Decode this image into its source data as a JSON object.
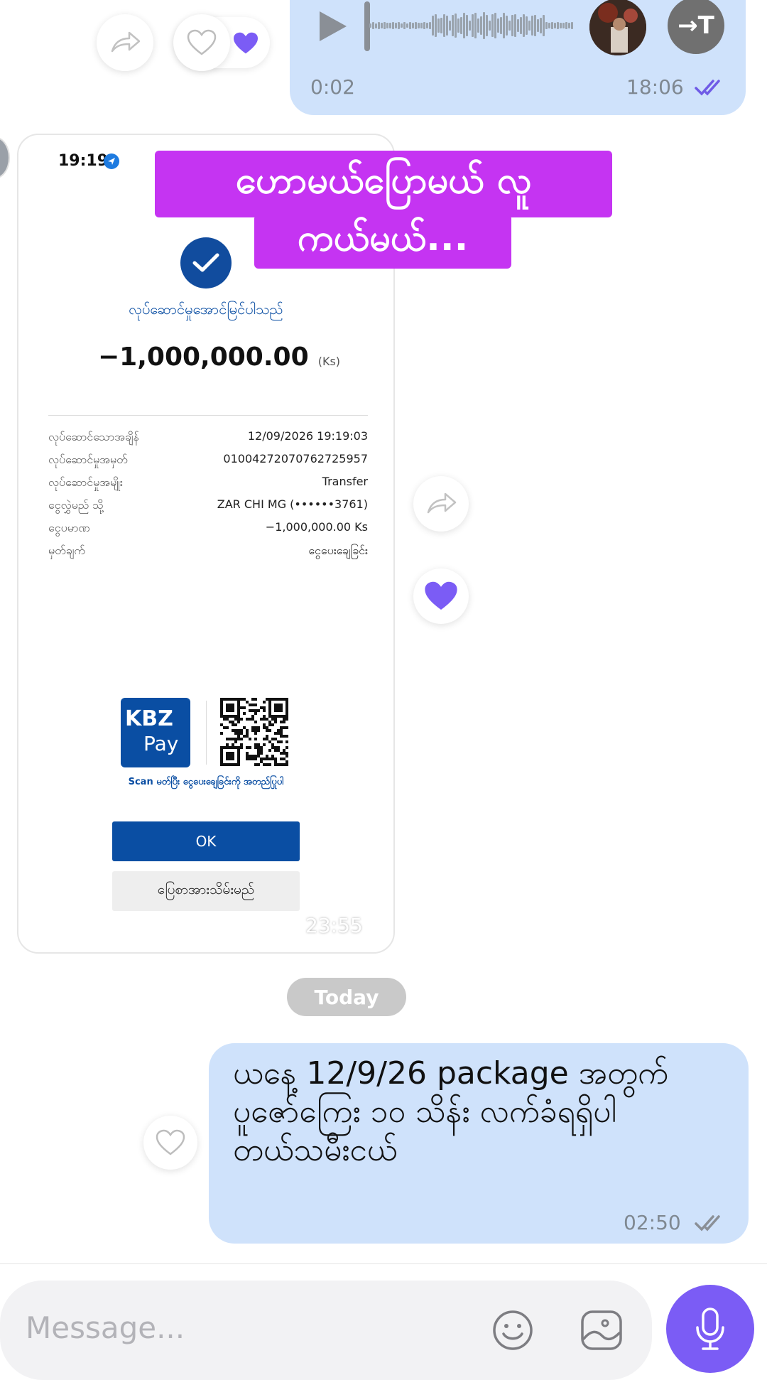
{
  "voice_message": {
    "duration": "0:02",
    "time": "18:06",
    "transcribe_label": "→T",
    "colors": {
      "bubble": "#cfe2fb",
      "ticks": "#6f5be6"
    }
  },
  "reactions": {
    "forward_icon": "forward-arrow-icon",
    "like_icon": "heart-icon",
    "liked_color": "#7b5cf5"
  },
  "receipt": {
    "status_time": "19:19",
    "sticker_line1": "ဟောမယ်ပြောမယ် လူ",
    "sticker_line2": "ကယ်မယ်...",
    "success_text": "လုပ်ဆောင်မှုအောင်မြင်ပါသည်",
    "amount": "−1,000,000.00",
    "currency": "(Ks)",
    "details": [
      {
        "label": "လုပ်ဆောင်သောအချိန်",
        "value": "12/09/2026 19:19:03"
      },
      {
        "label": "လုပ်ဆောင်မှုအမှတ်",
        "value": "01004272070762725957"
      },
      {
        "label": "လုပ်ဆောင်မှုအမျိုး",
        "value": "Transfer"
      },
      {
        "label": "ငွေလွှဲမည် သို့",
        "value": "ZAR CHI MG (••••••3761)"
      },
      {
        "label": "ငွေပမာဏ",
        "value": "−1,000,000.00 Ks"
      },
      {
        "label": "မှတ်ချက်",
        "value": "ငွေပေးချေခြင်း"
      }
    ],
    "logo_line1": "KBZ",
    "logo_line2": "Pay",
    "scan_text": "Scan မတ်ပြီး ငွေပေးချေခြင်းကို အတည်ပြုပါ",
    "ok_label": "OK",
    "save_label": "ပြေစာအားသိမ်းမည်",
    "time": "23:55",
    "colors": {
      "brand_blue": "#0a4ea3",
      "check_blue": "#114c9e"
    }
  },
  "date_divider": "Today",
  "outgoing_message": {
    "text_line1": "ယနေ့ 12/9/26 package အတွက်",
    "text_line2": "ပူဇော်ကြေး ၁၀ သိန်း လက်ခံရရှိပါ",
    "text_line3": "တယ်သမီးငယ်",
    "time": "02:50"
  },
  "composer": {
    "placeholder": "Message...",
    "accent": "#7b5cf5"
  }
}
